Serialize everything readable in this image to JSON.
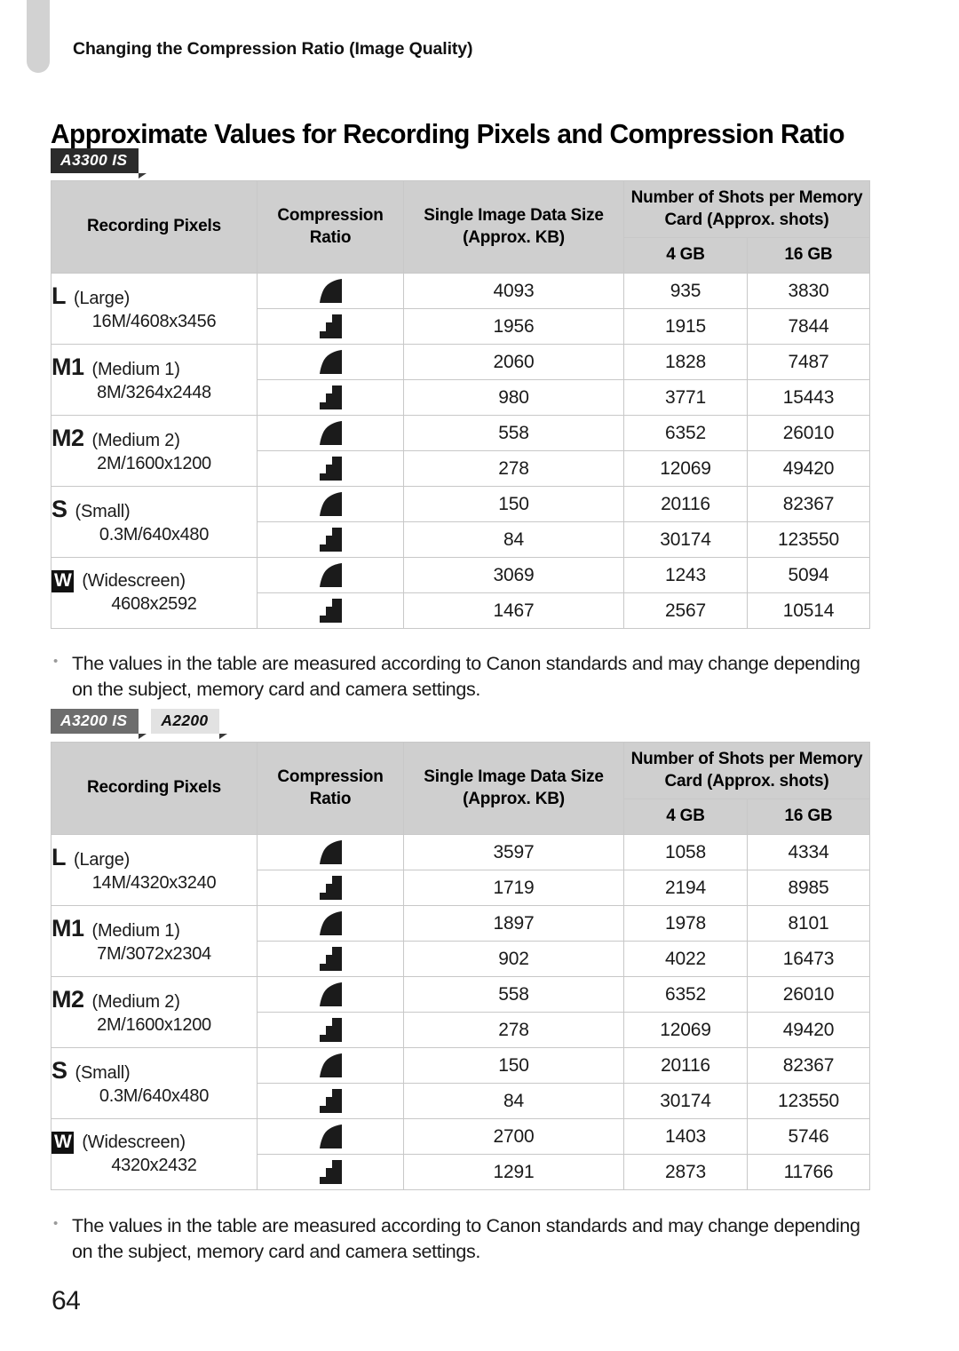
{
  "chapter_tab": "chapter-index-tab",
  "running_head": "Changing the Compression Ratio (Image Quality)",
  "section_title": "Approximate Values for Recording Pixels and Compression Ratio",
  "page_number": "64",
  "table_headers": {
    "recording_pixels": "Recording Pixels",
    "compression_ratio": "Compression Ratio",
    "single_image_data_size": "Single Image Data Size (Approx. KB)",
    "shots_per_card": "Number of Shots per Memory Card (Approx. shots)",
    "capacity_4gb": "4 GB",
    "capacity_16gb": "16 GB"
  },
  "icons": {
    "fine": "compression-fine-icon",
    "normal": "compression-normal-icon"
  },
  "note_text": "The values in the table are measured according to Canon standards and may change depending on the subject, memory card and camera settings.",
  "note_bullet": "•",
  "sections": [
    {
      "badges": [
        {
          "label": "A3300 IS",
          "style": "dark"
        }
      ],
      "rows": [
        {
          "glyph": "L",
          "glyph_boxed": false,
          "name": "(Large)",
          "dimensions": "16M/4608x3456",
          "entries": [
            {
              "ratio": "fine",
              "size_kb": "4093",
              "shots_4gb": "935",
              "shots_16gb": "3830"
            },
            {
              "ratio": "normal",
              "size_kb": "1956",
              "shots_4gb": "1915",
              "shots_16gb": "7844"
            }
          ]
        },
        {
          "glyph": "M1",
          "glyph_boxed": false,
          "name": "(Medium 1)",
          "dimensions": "8M/3264x2448",
          "entries": [
            {
              "ratio": "fine",
              "size_kb": "2060",
              "shots_4gb": "1828",
              "shots_16gb": "7487"
            },
            {
              "ratio": "normal",
              "size_kb": "980",
              "shots_4gb": "3771",
              "shots_16gb": "15443"
            }
          ]
        },
        {
          "glyph": "M2",
          "glyph_boxed": false,
          "name": "(Medium 2)",
          "dimensions": "2M/1600x1200",
          "entries": [
            {
              "ratio": "fine",
              "size_kb": "558",
              "shots_4gb": "6352",
              "shots_16gb": "26010"
            },
            {
              "ratio": "normal",
              "size_kb": "278",
              "shots_4gb": "12069",
              "shots_16gb": "49420"
            }
          ]
        },
        {
          "glyph": "S",
          "glyph_boxed": false,
          "name": "(Small)",
          "dimensions": "0.3M/640x480",
          "entries": [
            {
              "ratio": "fine",
              "size_kb": "150",
              "shots_4gb": "20116",
              "shots_16gb": "82367"
            },
            {
              "ratio": "normal",
              "size_kb": "84",
              "shots_4gb": "30174",
              "shots_16gb": "123550"
            }
          ]
        },
        {
          "glyph": "W",
          "glyph_boxed": true,
          "name": "(Widescreen)",
          "dimensions": "4608x2592",
          "entries": [
            {
              "ratio": "fine",
              "size_kb": "3069",
              "shots_4gb": "1243",
              "shots_16gb": "5094"
            },
            {
              "ratio": "normal",
              "size_kb": "1467",
              "shots_4gb": "2567",
              "shots_16gb": "10514"
            }
          ]
        }
      ]
    },
    {
      "badges": [
        {
          "label": "A3200 IS",
          "style": "mid"
        },
        {
          "label": "A2200",
          "style": "light"
        }
      ],
      "rows": [
        {
          "glyph": "L",
          "glyph_boxed": false,
          "name": "(Large)",
          "dimensions": "14M/4320x3240",
          "entries": [
            {
              "ratio": "fine",
              "size_kb": "3597",
              "shots_4gb": "1058",
              "shots_16gb": "4334"
            },
            {
              "ratio": "normal",
              "size_kb": "1719",
              "shots_4gb": "2194",
              "shots_16gb": "8985"
            }
          ]
        },
        {
          "glyph": "M1",
          "glyph_boxed": false,
          "name": "(Medium 1)",
          "dimensions": "7M/3072x2304",
          "entries": [
            {
              "ratio": "fine",
              "size_kb": "1897",
              "shots_4gb": "1978",
              "shots_16gb": "8101"
            },
            {
              "ratio": "normal",
              "size_kb": "902",
              "shots_4gb": "4022",
              "shots_16gb": "16473"
            }
          ]
        },
        {
          "glyph": "M2",
          "glyph_boxed": false,
          "name": "(Medium 2)",
          "dimensions": "2M/1600x1200",
          "entries": [
            {
              "ratio": "fine",
              "size_kb": "558",
              "shots_4gb": "6352",
              "shots_16gb": "26010"
            },
            {
              "ratio": "normal",
              "size_kb": "278",
              "shots_4gb": "12069",
              "shots_16gb": "49420"
            }
          ]
        },
        {
          "glyph": "S",
          "glyph_boxed": false,
          "name": "(Small)",
          "dimensions": "0.3M/640x480",
          "entries": [
            {
              "ratio": "fine",
              "size_kb": "150",
              "shots_4gb": "20116",
              "shots_16gb": "82367"
            },
            {
              "ratio": "normal",
              "size_kb": "84",
              "shots_4gb": "30174",
              "shots_16gb": "123550"
            }
          ]
        },
        {
          "glyph": "W",
          "glyph_boxed": true,
          "name": "(Widescreen)",
          "dimensions": "4320x2432",
          "entries": [
            {
              "ratio": "fine",
              "size_kb": "2700",
              "shots_4gb": "1403",
              "shots_16gb": "5746"
            },
            {
              "ratio": "normal",
              "size_kb": "1291",
              "shots_4gb": "2873",
              "shots_16gb": "11766"
            }
          ]
        }
      ]
    }
  ]
}
